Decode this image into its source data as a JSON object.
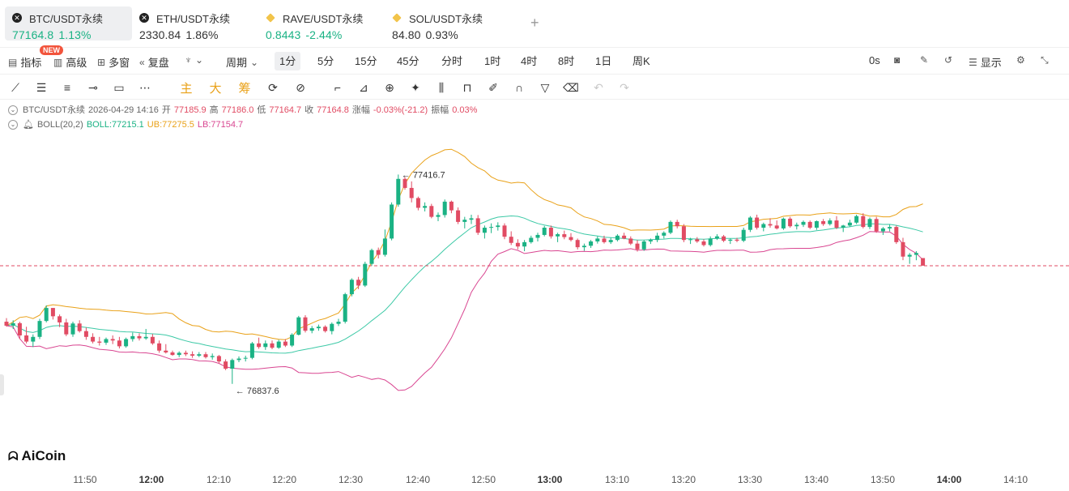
{
  "symbol_tabs": [
    {
      "name": "BTC/USDT永续",
      "price": "77164.8",
      "change": "1.13%",
      "direction": "up",
      "icon": "binance-x-icon",
      "active": true
    },
    {
      "name": "ETH/USDT永续",
      "price": "2330.84",
      "change": "1.86%",
      "direction": "neutral",
      "icon": "binance-x-icon",
      "active": false
    },
    {
      "name": "RAVE/USDT永续",
      "price": "0.8443",
      "change": "-2.44%",
      "direction": "up",
      "icon": "gold-diamond-icon",
      "active": false
    },
    {
      "name": "SOL/USDT永续",
      "price": "84.80",
      "change": "0.93%",
      "direction": "neutral",
      "icon": "gold-diamond-icon",
      "active": false
    }
  ],
  "add_tab_label": "+",
  "toolbar": {
    "indicators": "指标",
    "new_badge": "NEW",
    "advanced": "高级",
    "multi_window": "多窗",
    "replay": "复盘",
    "period": "周期",
    "timeframes": [
      "1分",
      "5分",
      "15分",
      "45分",
      "分时",
      "1时",
      "4时",
      "8时",
      "1日",
      "周K"
    ],
    "active_timeframe": "1分",
    "countdown": "0s",
    "display": "显示"
  },
  "draw_tools": {
    "text_labels": [
      "主",
      "大",
      "筹"
    ]
  },
  "legend": {
    "symbol": "BTC/USDT永续",
    "datetime": "2026-04-29 14:16",
    "open_label": "开",
    "open": "77185.9",
    "high_label": "高",
    "high": "77186.0",
    "low_label": "低",
    "low": "77164.7",
    "close_label": "收",
    "close": "77164.8",
    "change_label": "涨幅",
    "change": "-0.03%(-21.2)",
    "amplitude_label": "振幅",
    "amplitude": "0.03%",
    "boll_name": "BOLL(20,2)",
    "boll_mid": "BOLL:77215.1",
    "boll_ub": "UB:77275.5",
    "boll_lb": "LB:77154.7"
  },
  "chart_data": {
    "type": "candlestick",
    "interval": "1分",
    "price_range": [
      76600,
      77530
    ],
    "last_price": 77164.8,
    "annotations": {
      "high": "← 77416.7",
      "low": "← 76837.6"
    },
    "colors": {
      "up": "#1ab284",
      "down": "#e14b63",
      "mid": "#3cc9a6",
      "ub": "#e9a118",
      "lb": "#d94691"
    },
    "time_ticks": [
      "11:50",
      "12:00",
      "12:10",
      "12:20",
      "12:30",
      "12:40",
      "12:50",
      "13:00",
      "13:10",
      "13:20",
      "13:30",
      "13:40",
      "13:50",
      "14:00",
      "14:10"
    ],
    "bold_ticks": [
      "12:00",
      "13:00",
      "14:00"
    ],
    "candles": [
      [
        77010,
        77020,
        76996,
        76999
      ],
      [
        76999,
        77014,
        76990,
        77006
      ],
      [
        77006,
        77010,
        76962,
        76972
      ],
      [
        76972,
        76996,
        76950,
        76955
      ],
      [
        76955,
        76975,
        76940,
        76968
      ],
      [
        76968,
        77018,
        76962,
        77012
      ],
      [
        77012,
        77055,
        77008,
        77048
      ],
      [
        77048,
        77048,
        77016,
        77025
      ],
      [
        77025,
        77030,
        76995,
        77008
      ],
      [
        77008,
        77018,
        76970,
        76975
      ],
      [
        76975,
        77010,
        76968,
        77005
      ],
      [
        77005,
        77014,
        76980,
        76984
      ],
      [
        76984,
        76994,
        76960,
        76968
      ],
      [
        76968,
        76978,
        76950,
        76955
      ],
      [
        76955,
        76968,
        76944,
        76952
      ],
      [
        76952,
        76966,
        76946,
        76962
      ],
      [
        76962,
        76972,
        76948,
        76958
      ],
      [
        76958,
        76968,
        76936,
        76942
      ],
      [
        76942,
        76966,
        76938,
        76962
      ],
      [
        76962,
        76980,
        76955,
        76970
      ],
      [
        76970,
        76978,
        76958,
        76964
      ],
      [
        76964,
        76990,
        76960,
        76968
      ],
      [
        76968,
        76976,
        76946,
        76950
      ],
      [
        76950,
        76958,
        76924,
        76930
      ],
      [
        76930,
        76948,
        76922,
        76925
      ],
      [
        76925,
        76930,
        76916,
        76918
      ],
      [
        76918,
        76928,
        76912,
        76924
      ],
      [
        76924,
        76930,
        76915,
        76920
      ],
      [
        76920,
        76928,
        76910,
        76916
      ],
      [
        76916,
        76926,
        76912,
        76920
      ],
      [
        76920,
        76926,
        76908,
        76912
      ],
      [
        76912,
        76922,
        76905,
        76915
      ],
      [
        76915,
        76918,
        76895,
        76900
      ],
      [
        76900,
        76906,
        76876,
        76880
      ],
      [
        76880,
        76908,
        76838,
        76904
      ],
      [
        76904,
        76914,
        76898,
        76908
      ],
      [
        76908,
        76916,
        76900,
        76910
      ],
      [
        76910,
        76954,
        76906,
        76950
      ],
      [
        76950,
        76966,
        76935,
        76940
      ],
      [
        76940,
        76958,
        76932,
        76950
      ],
      [
        76950,
        76958,
        76934,
        76938
      ],
      [
        76938,
        76960,
        76935,
        76955
      ],
      [
        76955,
        76962,
        76940,
        76944
      ],
      [
        76944,
        76978,
        76940,
        76974
      ],
      [
        76974,
        77026,
        76972,
        77022
      ],
      [
        77022,
        77028,
        76980,
        76985
      ],
      [
        76985,
        76998,
        76978,
        76992
      ],
      [
        76992,
        77002,
        76985,
        76996
      ],
      [
        76996,
        77000,
        76980,
        76984
      ],
      [
        76984,
        77008,
        76975,
        77004
      ],
      [
        77004,
        77018,
        76998,
        77010
      ],
      [
        77010,
        77090,
        77005,
        77086
      ],
      [
        77086,
        77130,
        77080,
        77126
      ],
      [
        77126,
        77134,
        77100,
        77110
      ],
      [
        77110,
        77176,
        77106,
        77170
      ],
      [
        77170,
        77212,
        77165,
        77208
      ],
      [
        77208,
        77215,
        77185,
        77195
      ],
      [
        77195,
        77265,
        77190,
        77240
      ],
      [
        77240,
        77340,
        77235,
        77334
      ],
      [
        77334,
        77417,
        77328,
        77405
      ],
      [
        77405,
        77410,
        77375,
        77380
      ],
      [
        77380,
        77398,
        77340,
        77352
      ],
      [
        77352,
        77356,
        77318,
        77325
      ],
      [
        77325,
        77340,
        77315,
        77330
      ],
      [
        77330,
        77336,
        77296,
        77300
      ],
      [
        77300,
        77312,
        77288,
        77305
      ],
      [
        77305,
        77348,
        77298,
        77342
      ],
      [
        77342,
        77345,
        77310,
        77318
      ],
      [
        77318,
        77326,
        77280,
        77286
      ],
      [
        77286,
        77300,
        77268,
        77292
      ],
      [
        77292,
        77306,
        77280,
        77296
      ],
      [
        77296,
        77305,
        77250,
        77256
      ],
      [
        77256,
        77276,
        77240,
        77270
      ],
      [
        77270,
        77282,
        77255,
        77272
      ],
      [
        77272,
        77285,
        77262,
        77276
      ],
      [
        77276,
        77282,
        77238,
        77245
      ],
      [
        77245,
        77260,
        77222,
        77228
      ],
      [
        77228,
        77238,
        77210,
        77218
      ],
      [
        77218,
        77236,
        77205,
        77230
      ],
      [
        77230,
        77248,
        77226,
        77242
      ],
      [
        77242,
        77256,
        77232,
        77250
      ],
      [
        77250,
        77275,
        77246,
        77270
      ],
      [
        77270,
        77276,
        77240,
        77246
      ],
      [
        77246,
        77256,
        77230,
        77252
      ],
      [
        77252,
        77262,
        77238,
        77244
      ],
      [
        77244,
        77255,
        77232,
        77236
      ],
      [
        77236,
        77240,
        77210,
        77216
      ],
      [
        77216,
        77226,
        77206,
        77220
      ],
      [
        77220,
        77236,
        77214,
        77232
      ],
      [
        77232,
        77246,
        77226,
        77240
      ],
      [
        77240,
        77248,
        77226,
        77230
      ],
      [
        77230,
        77242,
        77225,
        77236
      ],
      [
        77236,
        77252,
        77232,
        77248
      ],
      [
        77248,
        77256,
        77238,
        77240
      ],
      [
        77240,
        77246,
        77222,
        77226
      ],
      [
        77226,
        77236,
        77204,
        77210
      ],
      [
        77210,
        77236,
        77206,
        77232
      ],
      [
        77232,
        77240,
        77225,
        77236
      ],
      [
        77236,
        77256,
        77230,
        77248
      ],
      [
        77248,
        77260,
        77240,
        77256
      ],
      [
        77256,
        77290,
        77252,
        77286
      ],
      [
        77286,
        77292,
        77268,
        77274
      ],
      [
        77274,
        77280,
        77230,
        77236
      ],
      [
        77236,
        77242,
        77225,
        77238
      ],
      [
        77238,
        77244,
        77228,
        77232
      ],
      [
        77232,
        77238,
        77218,
        77222
      ],
      [
        77222,
        77246,
        77218,
        77240
      ],
      [
        77240,
        77252,
        77236,
        77246
      ],
      [
        77246,
        77250,
        77230,
        77234
      ],
      [
        77234,
        77240,
        77225,
        77237
      ],
      [
        77237,
        77242,
        77230,
        77234
      ],
      [
        77234,
        77270,
        77230,
        77264
      ],
      [
        77264,
        77302,
        77258,
        77298
      ],
      [
        77298,
        77306,
        77265,
        77270
      ],
      [
        77270,
        77284,
        77260,
        77280
      ],
      [
        77280,
        77296,
        77270,
        77276
      ],
      [
        77276,
        77290,
        77265,
        77268
      ],
      [
        77268,
        77298,
        77264,
        77295
      ],
      [
        77295,
        77300,
        77270,
        77274
      ],
      [
        77274,
        77284,
        77265,
        77278
      ],
      [
        77278,
        77290,
        77272,
        77286
      ],
      [
        77286,
        77290,
        77266,
        77270
      ],
      [
        77270,
        77290,
        77264,
        77288
      ],
      [
        77288,
        77294,
        77275,
        77280
      ],
      [
        77280,
        77296,
        77276,
        77290
      ],
      [
        77290,
        77302,
        77266,
        77270
      ],
      [
        77270,
        77278,
        77258,
        77276
      ],
      [
        77276,
        77292,
        77272,
        77284
      ],
      [
        77284,
        77306,
        77280,
        77302
      ],
      [
        77302,
        77310,
        77268,
        77272
      ],
      [
        77272,
        77298,
        77266,
        77294
      ],
      [
        77294,
        77300,
        77256,
        77260
      ],
      [
        77260,
        77272,
        77250,
        77268
      ],
      [
        77268,
        77278,
        77260,
        77272
      ],
      [
        77272,
        77276,
        77225,
        77230
      ],
      [
        77230,
        77242,
        77180,
        77190
      ],
      [
        77190,
        77200,
        77170,
        77195
      ],
      [
        77195,
        77205,
        77180,
        77200
      ],
      [
        77186,
        77186,
        77165,
        77165
      ]
    ]
  }
}
